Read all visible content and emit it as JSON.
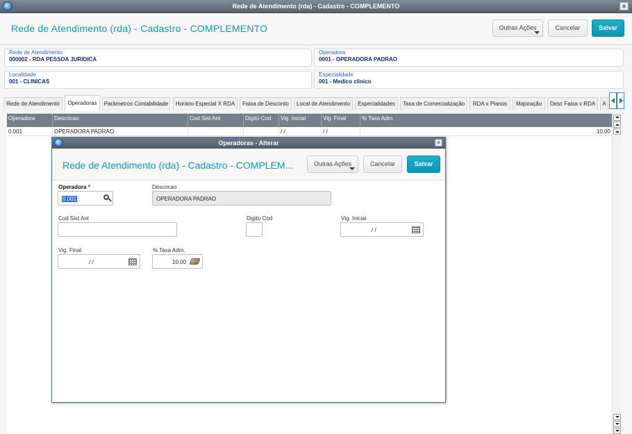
{
  "window": {
    "title": "Rede de Atendimento (rda) - Cadastro - COMPLEMENTO",
    "close_label": "×"
  },
  "header": {
    "title": "Rede de Atendimento (rda) - Cadastro - COMPLEMENTO",
    "outras_acoes": "Outras Ações",
    "cancelar": "Cancelar",
    "salvar": "Salvar"
  },
  "fields": {
    "rede": {
      "label": "Rede de Atendimento",
      "value": "000002  -  RDA PESSOA JURIDICA"
    },
    "operadora": {
      "label": "Operadora",
      "value": "0001  -  OPERADORA PADRAO"
    },
    "localidade": {
      "label": "Localidade",
      "value": "001 - CLINICAS"
    },
    "especialidade": {
      "label": "Especialidade",
      "value": "001 - Medico clinico"
    }
  },
  "tabs": [
    "Rede de Atendimento",
    "Operadoras",
    "Parâmetros Contabilidade",
    "Horário Especial X RDA",
    "Faixa de Desconto",
    "Local de Atendimento",
    "Especialidades",
    "Taxa de Comercialização",
    "RDA x Planos",
    "Majoração",
    "Desc Faixa x RDA",
    "A"
  ],
  "grid": {
    "columns": [
      "Operadora",
      "Descricao",
      "Cod Sist Ant",
      "Digito Cod",
      "Vig. Inicial",
      "Vig. Final",
      "% Taxa Adm."
    ],
    "rows": [
      [
        "0.001",
        "OPERADORA PADRAO",
        "",
        "",
        "/ /",
        "/ /",
        "10,00"
      ]
    ]
  },
  "dialog": {
    "title": "Operadoras - Alterar",
    "page_title": "Rede de Atendimento (rda) - Cadastro - COMPLEM...",
    "outras_acoes": "Outras Ações",
    "cancelar": "Cancelar",
    "salvar": "Salvar",
    "operadora_label": "Operadora",
    "operadora_required": "*",
    "operadora_value": "0.001",
    "descricao_label": "Descricao",
    "descricao_value": "OPERADORA PADRAO",
    "cod_sist_label": "Cod Sist Ant",
    "cod_sist_value": "",
    "digito_label": "Digito Cod",
    "digito_value": "",
    "vig_inicial_label": "Vig. Inicial",
    "vig_inicial_value": "/ /",
    "vig_final_label": "Vig. Final",
    "vig_final_value": "/ /",
    "taxa_label": "% Taxa Adm.",
    "taxa_value": "10,00"
  },
  "colors": {
    "accent": "#0d97b4",
    "primary_button": "#0796b3",
    "titlebar": "#56636f",
    "grid_header": "#73808c"
  },
  "icons": [
    "app-logo-icon",
    "close-icon",
    "chevron-down-icon",
    "tab-prev-icon",
    "tab-next-icon",
    "search-icon",
    "calendar-icon",
    "calculator-icon",
    "scroll-top-icon",
    "scroll-up-icon",
    "scroll-down-icon",
    "scroll-bottom-icon"
  ]
}
